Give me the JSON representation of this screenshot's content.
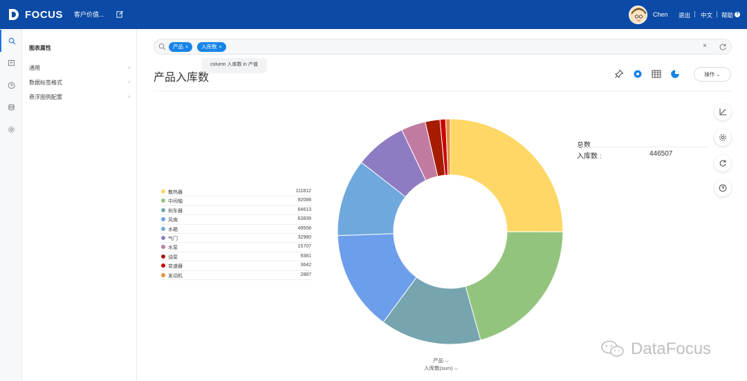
{
  "app": {
    "brand": "FOCUS",
    "title": "客户价值...",
    "user": "Chen",
    "links": {
      "logout": "退出",
      "lang": "中文",
      "help": "帮助"
    },
    "help_glyph": "?"
  },
  "rail": {
    "icons": [
      "search-icon",
      "bookmark-icon",
      "help-circle-icon",
      "database-icon",
      "gear-icon"
    ]
  },
  "panel": {
    "title": "图表属性",
    "items": [
      {
        "label": "通用"
      },
      {
        "label": "数据标签格式"
      },
      {
        "label": "悬浮图例配置"
      }
    ],
    "chevron": "›"
  },
  "search": {
    "chips": [
      {
        "label": "产品"
      },
      {
        "label": "入库数"
      }
    ],
    "chip_close": "×",
    "clear": "×",
    "tooltip": "column 入库数 in 产值"
  },
  "chart": {
    "title": "产品入库数",
    "ops_label": "操作 ⌄",
    "total_title": "总数",
    "total_label": "入库数 :",
    "total_value": "446507",
    "x_control": "产品 ⌵",
    "y_control": "入库数(sum) ⌵"
  },
  "chart_data": {
    "type": "pie",
    "donut": true,
    "categories": [
      "散热器",
      "中间轴",
      "刹车器",
      "风扇",
      "水箱",
      "气门",
      "水泵",
      "油泵",
      "变速器",
      "发动机"
    ],
    "values": [
      111812,
      92088,
      64613,
      63839,
      49558,
      32980,
      15707,
      9381,
      3642,
      2887
    ],
    "value_labels": [
      "111812",
      "92088",
      "64613",
      "63839",
      "49558",
      "32980",
      "15707",
      "9381",
      "3642",
      "2887"
    ],
    "colors": [
      "#fed766",
      "#93c47d",
      "#76a5af",
      "#6d9eeb",
      "#6fa8dc",
      "#8e7cc3",
      "#c27ba0",
      "#a61c00",
      "#cc0000",
      "#e69138"
    ],
    "title": "产品入库数",
    "legend": "left",
    "total": 446507
  },
  "watermark": "DataFocus"
}
